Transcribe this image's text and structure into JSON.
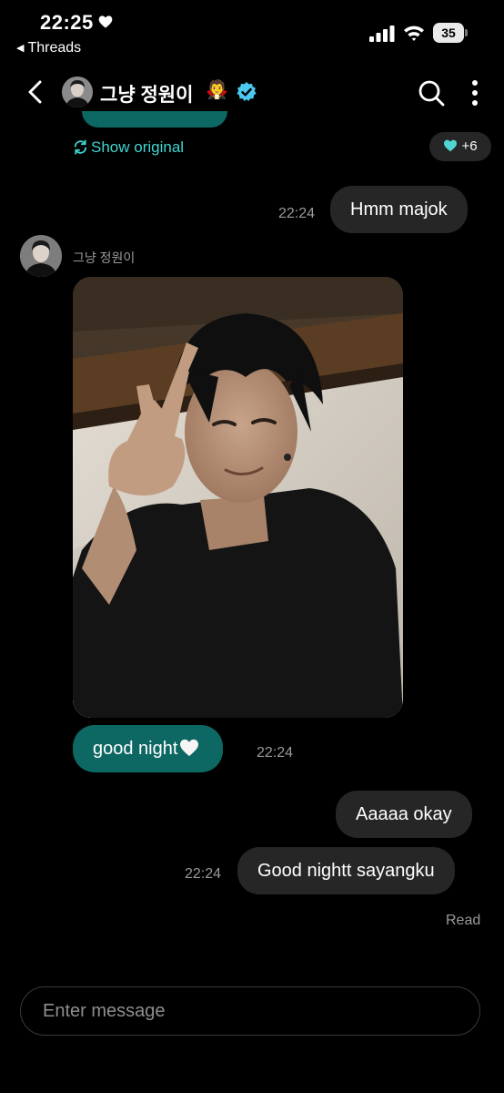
{
  "status_bar": {
    "time": "22:25",
    "back_app": "Threads",
    "battery": "35"
  },
  "header": {
    "contact_name": "그냥 정원이",
    "emoji": "🧛",
    "verified_color": "#4cc9f0"
  },
  "chat": {
    "show_original": "Show original",
    "reaction_count": "+6",
    "accent_color": "#0d6763",
    "messages": [
      {
        "direction": "out",
        "time": "22:24",
        "text": "Hmm majok"
      },
      {
        "direction": "in",
        "sender": "그냥 정원이",
        "type": "photo"
      },
      {
        "direction": "in",
        "time": "22:24",
        "text": "good night"
      },
      {
        "direction": "out",
        "text": "Aaaaa okay"
      },
      {
        "direction": "out",
        "time": "22:24",
        "text": "Good nightt sayangku"
      }
    ],
    "read_label": "Read"
  },
  "composer": {
    "placeholder": "Enter message"
  }
}
